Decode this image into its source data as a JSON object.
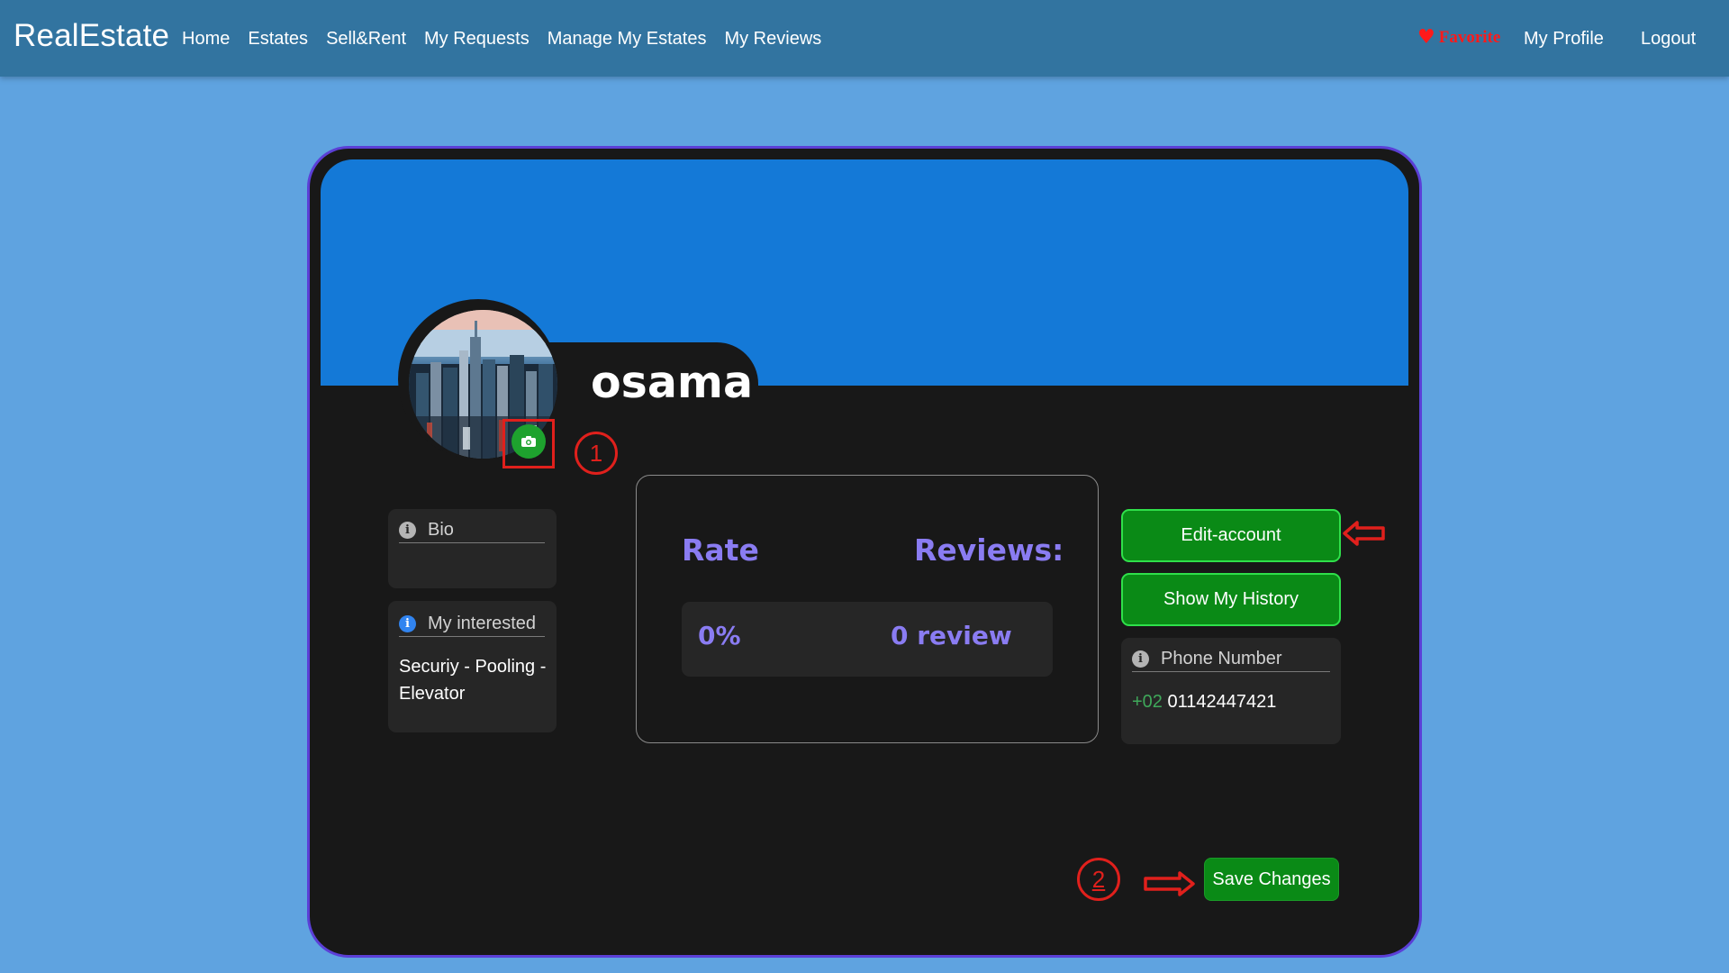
{
  "navbar": {
    "brand": "RealEstate",
    "links": [
      "Home",
      "Estates",
      "Sell&Rent",
      "My Requests",
      "Manage My Estates",
      "My Reviews"
    ],
    "favorite_label": "Favorite",
    "favorite_icon": "heart-icon",
    "profile_label": "My Profile",
    "logout_label": "Logout"
  },
  "profile": {
    "username": "osama",
    "avatar": "city-skyline-photo",
    "camera_icon": "camera-icon",
    "bio": {
      "title": "Bio",
      "text": ""
    },
    "interested": {
      "title": "My interested",
      "text": "Securiy - Pooling - Elevator"
    },
    "rating": {
      "rate_label": "Rate",
      "reviews_label": "Reviews:",
      "rate_value": "0%",
      "reviews_value": "0 review"
    },
    "buttons": {
      "edit": "Edit-account",
      "history": "Show My History",
      "save": "Save Changes"
    },
    "phone": {
      "title": "Phone Number",
      "code": "+02",
      "number": "01142447421"
    }
  },
  "annotations": {
    "marker_1": "1",
    "marker_2": "2"
  },
  "colors": {
    "page_bg": "#5fa3e0",
    "navbar_bg": "#3274a0",
    "banner": "#1479d7",
    "card_bg": "#181818",
    "accent_green": "#0a8a16",
    "rating_text": "#8a7cf2",
    "annotation_red": "#e0201c"
  }
}
